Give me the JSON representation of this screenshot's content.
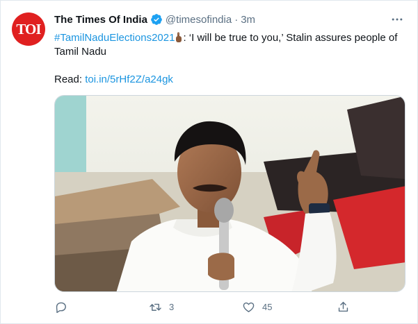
{
  "tweet": {
    "avatar_text": "TOI",
    "author_name": "The Times Of India",
    "handle": "@timesofindia",
    "separator": "·",
    "time": "3m",
    "hashtag": "#TamilNaduElections2021",
    "text_after_emoji": ": ‘I will be true to you,’ Stalin assures people of Tamil Nadu",
    "read_label": "Read: ",
    "link": "toi.in/5rHf2Z/a24gk"
  },
  "actions": {
    "reply_count": "",
    "retweet_count": "3",
    "like_count": "45"
  },
  "icons": [
    "more-icon",
    "verified-icon",
    "reply-icon",
    "retweet-icon",
    "like-icon",
    "share-icon"
  ],
  "colors": {
    "link": "#1b95e0",
    "muted": "#5b7083",
    "brand": "#e02020"
  }
}
